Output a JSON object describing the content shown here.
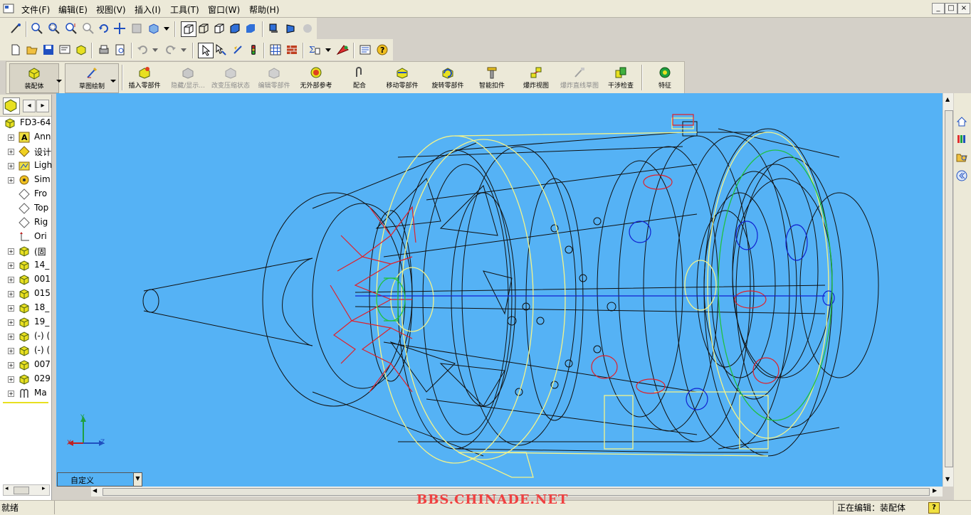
{
  "menu": {
    "items": [
      "文件(F)",
      "编辑(E)",
      "视图(V)",
      "插入(I)",
      "工具(T)",
      "窗口(W)",
      "帮助(H)"
    ],
    "window_buttons": [
      "_",
      "□",
      "×"
    ]
  },
  "command_manager": {
    "tabs": [
      {
        "label": "装配体"
      },
      {
        "label": "草图绘制"
      }
    ],
    "commands": [
      {
        "label": "插入零部件",
        "icon": "insert-component-icon",
        "enabled": true
      },
      {
        "label": "隐藏/显示...",
        "icon": "hide-show-icon",
        "enabled": false
      },
      {
        "label": "改变压缩状态",
        "icon": "suppress-state-icon",
        "enabled": false
      },
      {
        "label": "编辑零部件",
        "icon": "edit-component-icon",
        "enabled": false
      },
      {
        "label": "无外部参考",
        "icon": "no-external-ref-icon",
        "enabled": true
      },
      {
        "label": "配合",
        "icon": "mate-icon",
        "enabled": true
      },
      {
        "label": "移动零部件",
        "icon": "move-component-icon",
        "enabled": true
      },
      {
        "label": "旋转零部件",
        "icon": "rotate-component-icon",
        "enabled": true
      },
      {
        "label": "智能扣件",
        "icon": "smart-fastener-icon",
        "enabled": true
      },
      {
        "label": "爆炸视图",
        "icon": "exploded-view-icon",
        "enabled": true
      },
      {
        "label": "爆炸直线草图",
        "icon": "explode-line-sketch-icon",
        "enabled": false
      },
      {
        "label": "干涉检查",
        "icon": "interference-check-icon",
        "enabled": true
      },
      {
        "label": "特征",
        "icon": "features-icon",
        "enabled": true
      }
    ]
  },
  "feature_tree": {
    "items": [
      {
        "label": "FD3-64",
        "icon": "assembly-icon",
        "expander": false
      },
      {
        "label": "Ann",
        "icon": "annotations-icon",
        "expander": true
      },
      {
        "label": "设计",
        "icon": "design-binder-icon",
        "expander": true
      },
      {
        "label": "Ligh",
        "icon": "lights-icon",
        "expander": true
      },
      {
        "label": "Sim",
        "icon": "simulation-icon",
        "expander": true
      },
      {
        "label": "Fro",
        "icon": "plane-icon",
        "expander": false
      },
      {
        "label": "Top",
        "icon": "plane-icon",
        "expander": false
      },
      {
        "label": "Rig",
        "icon": "plane-icon",
        "expander": false
      },
      {
        "label": "Ori",
        "icon": "origin-icon",
        "expander": false
      },
      {
        "label": "(固",
        "icon": "part-icon",
        "expander": true
      },
      {
        "label": "14_",
        "icon": "part-icon",
        "expander": true
      },
      {
        "label": "001",
        "icon": "part-icon",
        "expander": true
      },
      {
        "label": "015",
        "icon": "part-icon",
        "expander": true
      },
      {
        "label": "18_",
        "icon": "part-icon",
        "expander": true
      },
      {
        "label": "19_",
        "icon": "part-icon",
        "expander": true
      },
      {
        "label": "(-) (",
        "icon": "part-icon",
        "expander": true
      },
      {
        "label": "(-) (",
        "icon": "part-icon",
        "expander": true
      },
      {
        "label": "007",
        "icon": "part-icon",
        "expander": true
      },
      {
        "label": "029",
        "icon": "part-icon",
        "expander": true
      },
      {
        "label": "Ma",
        "icon": "mates-icon",
        "expander": true
      }
    ]
  },
  "viewport": {
    "background": "#55b2f5",
    "triad": {
      "y": "Y",
      "x": "X",
      "z": "Z"
    },
    "view_dropdown": "自定义"
  },
  "status_bar": {
    "left": "就绪",
    "right": "正在编辑：装配体",
    "help_icon": "?"
  },
  "watermark": "BBS.CHINADE.NET",
  "colors": {
    "chrome": "#ece9d8",
    "viewport_bg": "#55b2f5",
    "wire_black": "#101010",
    "wire_yellow": "#f4f48a",
    "wire_red": "#e0202a",
    "wire_blue": "#1020d0",
    "wire_green": "#20c040"
  }
}
